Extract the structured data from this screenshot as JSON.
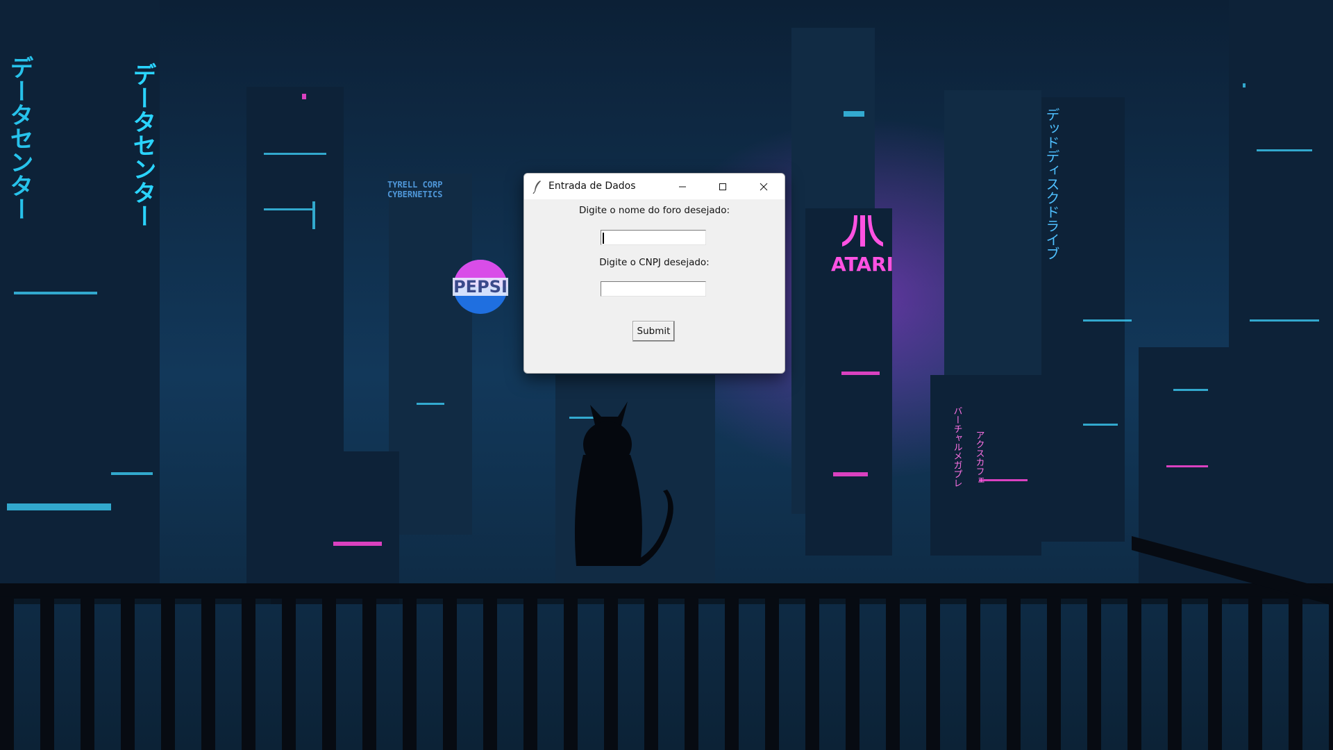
{
  "wallpaper": {
    "signs": {
      "tyrell_line1": "TYRELL CORP",
      "tyrell_line2": "CYBERNETICS",
      "pepsi": "PEPSI",
      "atari": "ATARI",
      "jp_left": "データセンター",
      "jp_right": "デッドディスクドライブ",
      "jp_center": "バーチャルメガプレ アクスカフェ"
    },
    "colors": {
      "sky": "#0f2a44",
      "neon_cyan": "#2ad4ff",
      "neon_magenta": "#ff3fd8",
      "railing": "#0a0f16"
    }
  },
  "dialog": {
    "title": "Entrada de Dados",
    "icon": "tk-feather-icon",
    "label_foro": "Digite o nome do foro desejado:",
    "foro_value": "",
    "label_cnpj": "Digite o CNPJ desejado:",
    "cnpj_value": "",
    "submit_label": "Submit",
    "controls": [
      "minimize-icon",
      "maximize-icon",
      "close-icon"
    ]
  }
}
